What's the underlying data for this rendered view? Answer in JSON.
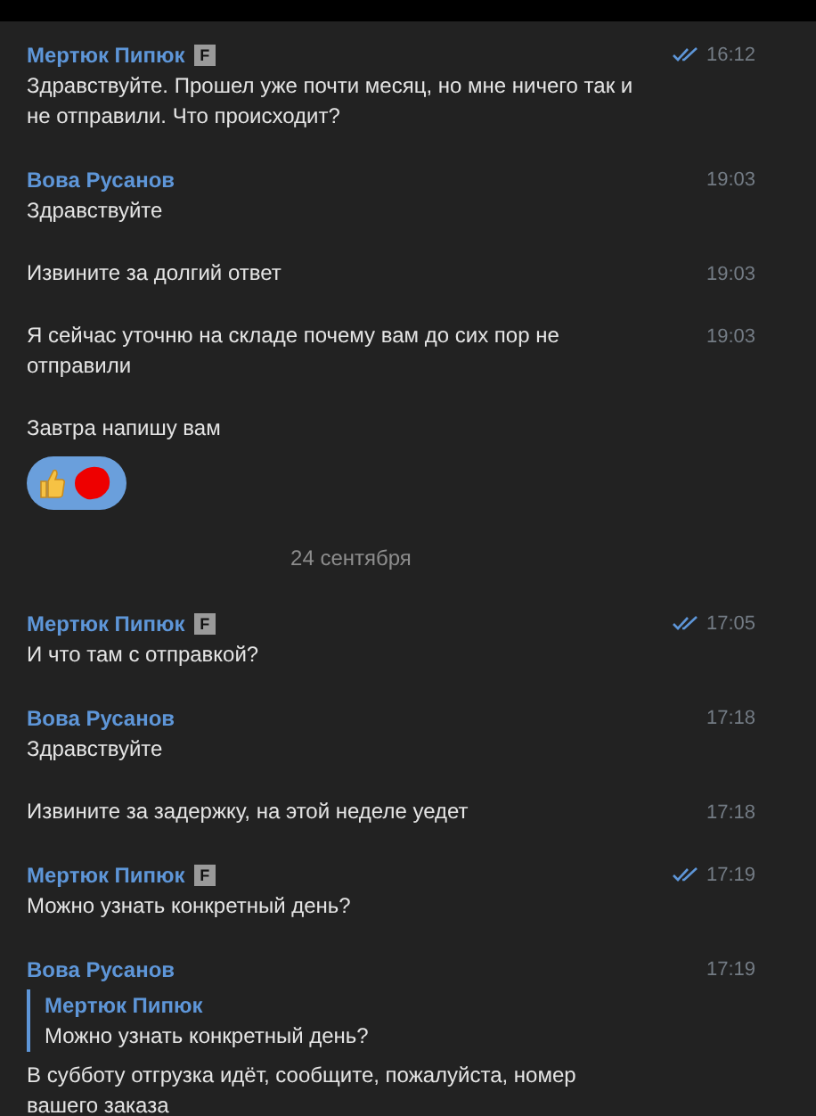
{
  "messages": [
    {
      "kind": "message",
      "author": "Мертюк Пипюк",
      "badge": "F",
      "time": "16:12",
      "read": true,
      "text": "Здравствуйте. Прошел уже почти месяц, но мне ничего так и не отправили. Что происходит?"
    },
    {
      "kind": "message",
      "author": "Вова Русанов",
      "time": "19:03",
      "read": false,
      "text": "Здравствуйте"
    },
    {
      "kind": "message",
      "time": "19:03",
      "read": false,
      "text": "Извините за долгий ответ"
    },
    {
      "kind": "message",
      "time": "19:03",
      "read": false,
      "text": "Я сейчас уточню на складе почему вам до сих пор не отправили"
    },
    {
      "kind": "message",
      "read": false,
      "text": "Завтра напишу вам",
      "reactions": true
    },
    {
      "kind": "date",
      "text": "24 сентября"
    },
    {
      "kind": "message",
      "author": "Мертюк Пипюк",
      "badge": "F",
      "time": "17:05",
      "read": true,
      "text": "И что там с отправкой?"
    },
    {
      "kind": "message",
      "author": "Вова Русанов",
      "time": "17:18",
      "read": false,
      "text": "Здравствуйте"
    },
    {
      "kind": "message",
      "time": "17:18",
      "read": false,
      "text": "Извините за задержку, на этой неделе уедет"
    },
    {
      "kind": "message",
      "author": "Мертюк Пипюк",
      "badge": "F",
      "time": "17:19",
      "read": true,
      "text": "Можно узнать конкретный день?"
    },
    {
      "kind": "message",
      "author": "Вова Русанов",
      "time": "17:19",
      "read": false,
      "reply": {
        "author": "Мертюк Пипюк",
        "text": "Можно узнать конкретный день?"
      },
      "text": "В субботу отгрузка идёт, сообщите, пожалуйста, номер вашего заказа"
    }
  ]
}
